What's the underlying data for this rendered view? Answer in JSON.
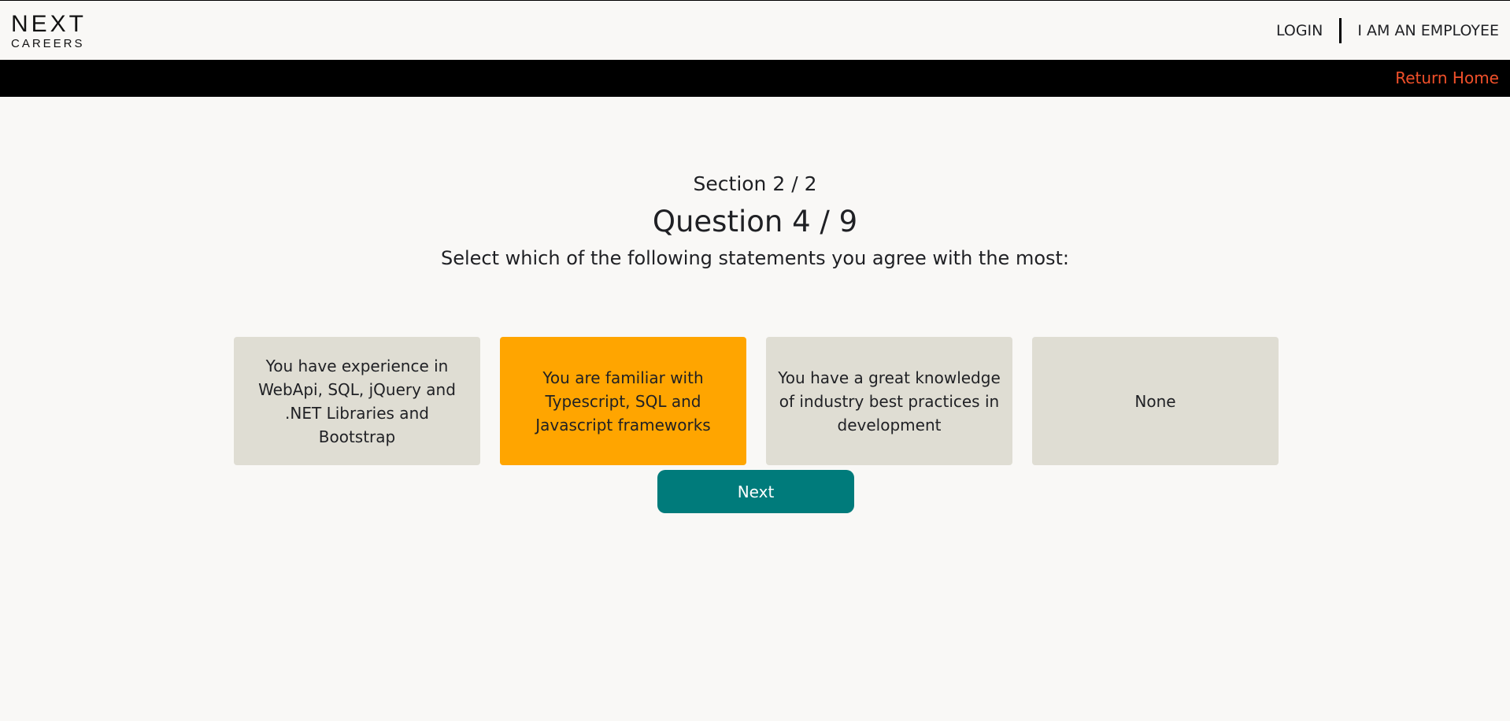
{
  "header": {
    "logo_line1": "NEXT",
    "logo_line2": "CAREERS",
    "nav": {
      "login": "LOGIN",
      "employee": "I AM AN EMPLOYEE"
    }
  },
  "subnav": {
    "return_home": "Return Home"
  },
  "quiz": {
    "section": "Section 2 / 2",
    "question": "Question 4 / 9",
    "prompt": "Select which of the following statements you agree with the most:",
    "options": [
      {
        "label": "You have experience in WebApi, SQL, jQuery and .NET Libraries and Bootstrap",
        "selected": false
      },
      {
        "label": "You are familiar with Typescript, SQL and Javascript frameworks",
        "selected": true
      },
      {
        "label": "You have a great knowledge of industry best practices in development",
        "selected": false
      },
      {
        "label": "None",
        "selected": false
      }
    ],
    "next_label": "Next"
  },
  "colors": {
    "accent_link": "#f0502a",
    "selected_option": "#ffa500",
    "option_default": "#dfddd3",
    "next_button": "#007b7b",
    "bar": "#000000"
  }
}
